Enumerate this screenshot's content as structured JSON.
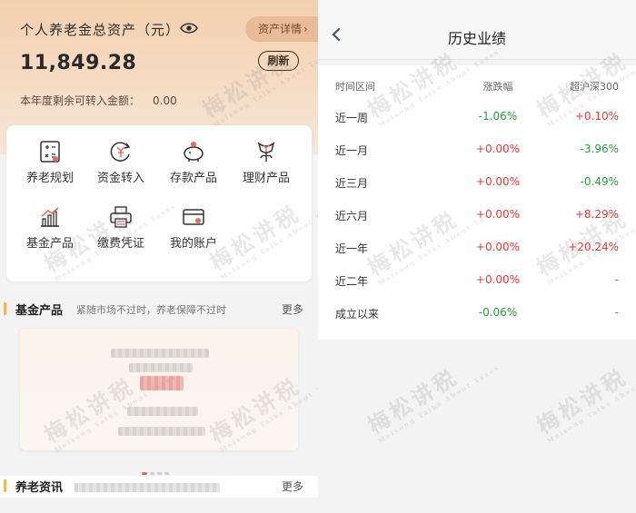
{
  "left": {
    "header": {
      "title": "个人养老金总资产（元）",
      "asset_detail_label": "资产详情",
      "amount": "11,849.28",
      "refresh_label": "刷新",
      "remaining_label": "本年度剩余可转入金额：",
      "remaining_value": "0.00"
    },
    "menu": [
      {
        "label": "养老规划",
        "icon": "calculator-icon"
      },
      {
        "label": "资金转入",
        "icon": "yuan-transfer-icon"
      },
      {
        "label": "存款产品",
        "icon": "piggy-bank-icon"
      },
      {
        "label": "理财产品",
        "icon": "money-plant-icon"
      },
      {
        "label": "基金产品",
        "icon": "bar-chart-icon"
      },
      {
        "label": "缴费凭证",
        "icon": "printer-icon"
      },
      {
        "label": "我的账户",
        "icon": "account-card-icon"
      }
    ],
    "fund_section": {
      "title": "基金产品",
      "subtitle": "紧随市场不过时，养老保障不过时",
      "more": "更多"
    },
    "news_section": {
      "title": "养老资讯",
      "more": "更多"
    }
  },
  "right": {
    "title": "历史业绩",
    "columns": [
      "时间区间",
      "涨跌幅",
      "超沪深300"
    ],
    "rows": [
      {
        "period": "近一周",
        "change": "-1.06%",
        "change_sign": "neg",
        "excess": "+0.10%",
        "excess_sign": "pos"
      },
      {
        "period": "近一月",
        "change": "+0.00%",
        "change_sign": "pos",
        "excess": "-3.96%",
        "excess_sign": "neg"
      },
      {
        "period": "近三月",
        "change": "+0.00%",
        "change_sign": "pos",
        "excess": "-0.49%",
        "excess_sign": "neg"
      },
      {
        "period": "近六月",
        "change": "+0.00%",
        "change_sign": "pos",
        "excess": "+8.29%",
        "excess_sign": "pos"
      },
      {
        "period": "近一年",
        "change": "+0.00%",
        "change_sign": "pos",
        "excess": "+20.24%",
        "excess_sign": "pos"
      },
      {
        "period": "近二年",
        "change": "+0.00%",
        "change_sign": "pos",
        "excess": "-",
        "excess_sign": "pos"
      },
      {
        "period": "成立以来",
        "change": "-0.06%",
        "change_sign": "neg",
        "excess": "-",
        "excess_sign": "pos"
      }
    ]
  },
  "watermark": {
    "main": "梅松讲税",
    "sub": "Meisong Talks About Taxes"
  },
  "colors": {
    "positive": "#e23b3b",
    "negative": "#2b9a3e",
    "accent": "#f0b760"
  }
}
